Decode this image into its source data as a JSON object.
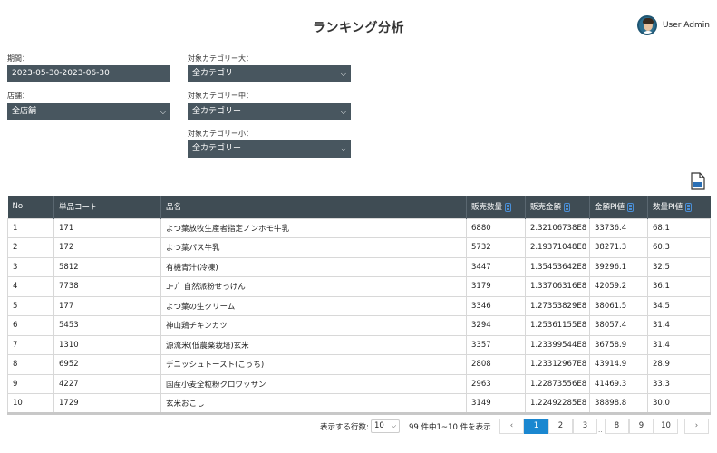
{
  "header": {
    "title": "ランキング分析",
    "user_name": "User Admin"
  },
  "filters": {
    "period_label": "期間：",
    "period_value": "2023-05-30-2023-06-30",
    "store_label": "店舗：",
    "store_value": "全店舗",
    "cat_large_label": "対象カテゴリー大：",
    "cat_large_value": "全カテゴリー",
    "cat_mid_label": "対象カテゴリー中：",
    "cat_mid_value": "全カテゴリー",
    "cat_small_label": "対象カテゴリー小：",
    "cat_small_value": "全カテゴリー"
  },
  "export": {
    "icon": "csv-export-icon"
  },
  "table": {
    "headers": [
      "No",
      "単品コート",
      "品名",
      "販売数量",
      "販売金額",
      "金額PI値",
      "数量PI値"
    ],
    "rows": [
      [
        "1",
        "171",
        "よつ葉放牧生産者指定ノンホモ牛乳",
        "6880",
        "2.32106738E8",
        "33736.4",
        "68.1"
      ],
      [
        "2",
        "172",
        "よつ葉パス牛乳",
        "5732",
        "2.19371048E8",
        "38271.3",
        "60.3"
      ],
      [
        "3",
        "5812",
        "有機青汁(冷凍)",
        "3447",
        "1.35453642E8",
        "39296.1",
        "32.5"
      ],
      [
        "4",
        "7738",
        "ｺｰﾌﾟ 自然派粉せっけん",
        "3179",
        "1.33706316E8",
        "42059.2",
        "36.1"
      ],
      [
        "5",
        "177",
        "よつ葉の生クリーム",
        "3346",
        "1.27353829E8",
        "38061.5",
        "34.5"
      ],
      [
        "6",
        "5453",
        "神山鶏チキンカツ",
        "3294",
        "1.25361155E8",
        "38057.4",
        "31.4"
      ],
      [
        "7",
        "1310",
        "源流米(低農薬栽培)玄米",
        "3357",
        "1.23399544E8",
        "36758.9",
        "31.4"
      ],
      [
        "8",
        "6952",
        "デニッシュトースト(こうち)",
        "2808",
        "1.23312967E8",
        "43914.9",
        "28.9"
      ],
      [
        "9",
        "4227",
        "国産小麦全粒粉クロワッサン",
        "2963",
        "1.22873556E8",
        "41469.3",
        "33.3"
      ],
      [
        "10",
        "1729",
        "玄米おこし",
        "3149",
        "1.22492285E8",
        "38898.8",
        "30.0"
      ]
    ]
  },
  "pagination": {
    "rows_label": "表示する行数:",
    "rows_value": "10",
    "summary": "99 件中1~10 件を表示",
    "prev": "‹",
    "next": "›",
    "pages": [
      "1",
      "2",
      "3",
      "8",
      "9",
      "10"
    ],
    "ellipsis": "..",
    "active_page": "1"
  }
}
